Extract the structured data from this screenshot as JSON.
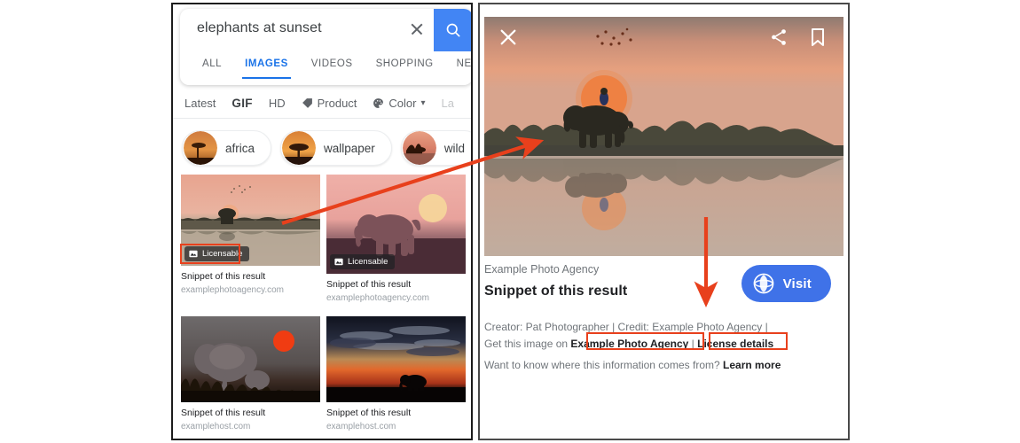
{
  "search": {
    "query": "elephants at sunset",
    "clear_icon": "close-icon",
    "search_icon": "search-icon",
    "tabs": [
      {
        "label": "ALL",
        "active": false
      },
      {
        "label": "IMAGES",
        "active": true
      },
      {
        "label": "VIDEOS",
        "active": false
      },
      {
        "label": "SHOPPING",
        "active": false
      },
      {
        "label": "NEWS",
        "active": false
      }
    ],
    "filters": [
      {
        "label": "Latest",
        "icon": null
      },
      {
        "label": "GIF",
        "icon": null
      },
      {
        "label": "HD",
        "icon": null
      },
      {
        "label": "Product",
        "icon": "tag-icon"
      },
      {
        "label": "Color",
        "icon": "palette-icon",
        "caret": "▾"
      },
      {
        "label": "La",
        "icon": null
      }
    ],
    "chips": [
      {
        "label": "africa"
      },
      {
        "label": "wallpaper"
      },
      {
        "label": "wild"
      }
    ]
  },
  "results": [
    {
      "title": "Snippet of this result",
      "url": "examplephotoagency.com",
      "badge": "Licensable",
      "badge_icon": "image-icon",
      "highlighted": true
    },
    {
      "title": "Snippet of this result",
      "url": "examplephotoagency.com",
      "badge": "Licensable",
      "badge_icon": "image-icon",
      "highlighted": false
    },
    {
      "title": "Snippet of this result",
      "url": "examplehost.com",
      "badge": null,
      "badge_icon": null,
      "highlighted": false
    },
    {
      "title": "Snippet of this result",
      "url": "examplehost.com",
      "badge": null,
      "badge_icon": null,
      "highlighted": false
    }
  ],
  "viewer": {
    "close_icon": "close-icon",
    "share_icon": "share-icon",
    "bookmark_icon": "bookmark-icon",
    "source_name": "Example Photo Agency",
    "snippet_title": "Snippet of this result",
    "visit_label": "Visit",
    "visit_icon": "globe-icon",
    "credit_line_1": "Creator: Pat Photographer | Credit: Example Photo Agency |",
    "credit_line_2_prefix": "Get this image on",
    "credit_link_1": "Example Photo Agency",
    "credit_separator": "|",
    "credit_link_2": "License details",
    "learn_prefix": "Want to know where this information comes from?",
    "learn_link": "Learn more"
  },
  "colors": {
    "accent_blue": "#4285f4",
    "tab_blue": "#1a73e8",
    "annotation_red": "#e8401c",
    "visit_blue": "#3f72e8",
    "text_primary": "#202124",
    "text_secondary": "#70757a"
  }
}
